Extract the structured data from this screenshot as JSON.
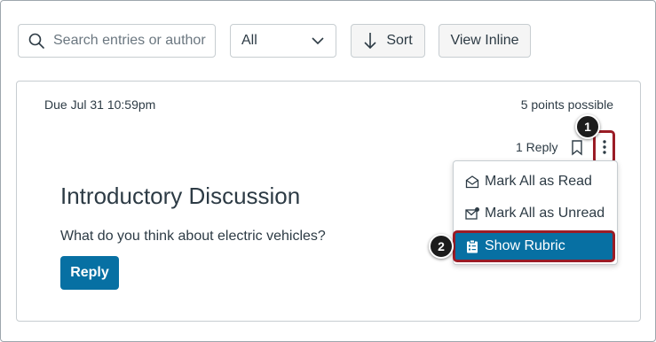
{
  "toolbar": {
    "search_placeholder": "Search entries or author",
    "filter_value": "All",
    "sort_label": "Sort",
    "view_inline_label": "View Inline"
  },
  "discussion": {
    "due": "Due Jul 31 10:59pm",
    "points": "5 points possible",
    "reply_count": "1 Reply",
    "title": "Introductory Discussion",
    "question": "What do you think about electric vehicles?",
    "reply_label": "Reply"
  },
  "menu": {
    "items": [
      {
        "label": "Mark All as Read",
        "icon": "envelope-open-icon"
      },
      {
        "label": "Mark All as Unread",
        "icon": "envelope-unread-icon"
      },
      {
        "label": "Show Rubric",
        "icon": "rubric-icon"
      }
    ]
  },
  "callouts": [
    "1",
    "2"
  ],
  "colors": {
    "primary": "#0770a3",
    "highlight": "#9b1c26",
    "text": "#2d3b45"
  }
}
